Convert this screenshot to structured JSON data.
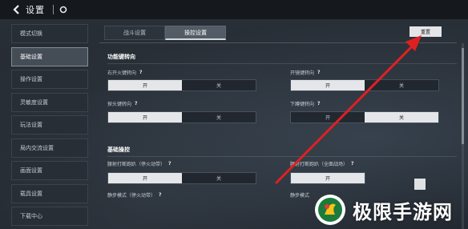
{
  "header": {
    "title": "设置"
  },
  "sidebar": {
    "items": [
      {
        "label": "模式切换",
        "active": false
      },
      {
        "label": "基础设置",
        "active": true
      },
      {
        "label": "操作设置",
        "active": false
      },
      {
        "label": "灵敏度设置",
        "active": false
      },
      {
        "label": "玩法设置",
        "active": false
      },
      {
        "label": "局内交流设置",
        "active": false
      },
      {
        "label": "画面设置",
        "active": false
      },
      {
        "label": "载具设置",
        "active": false
      },
      {
        "label": "下载中心",
        "active": false
      }
    ]
  },
  "tabs": [
    {
      "label": "战斗设置",
      "active": false
    },
    {
      "label": "操控设置",
      "active": true
    }
  ],
  "reset_label": "重置",
  "sections": {
    "function_key_title": "功能键转向",
    "basic_control_title": "基础操控"
  },
  "options": {
    "right_fire": {
      "label": "右开火键转向",
      "on": "开",
      "off": "关",
      "selected": "on"
    },
    "scope": {
      "label": "开镜键转向",
      "on": "开",
      "off": "关",
      "selected": "on"
    },
    "lean": {
      "label": "探头键转向",
      "on": "开",
      "off": "关",
      "selected": "on"
    },
    "crouch": {
      "label": "下蹲键转向",
      "on": "开",
      "off": "关",
      "selected": "off"
    },
    "gyro_fire": {
      "label": "腰射打断跑趴（停火动带）",
      "on": "开",
      "off": "关",
      "selected": "on"
    },
    "gyro_fire2": {
      "label": "腰射打断跑趴（全面战场）",
      "on": "开",
      "off": "关",
      "selected": "on"
    },
    "quiet_mode": {
      "label": "静步模式（停火动带）"
    },
    "extra": {
      "label": "静步模式"
    }
  },
  "watermark": {
    "text": "极限手游网"
  },
  "colors": {
    "arrow": "#e02020",
    "toggle_on": "#e4e6e9"
  }
}
